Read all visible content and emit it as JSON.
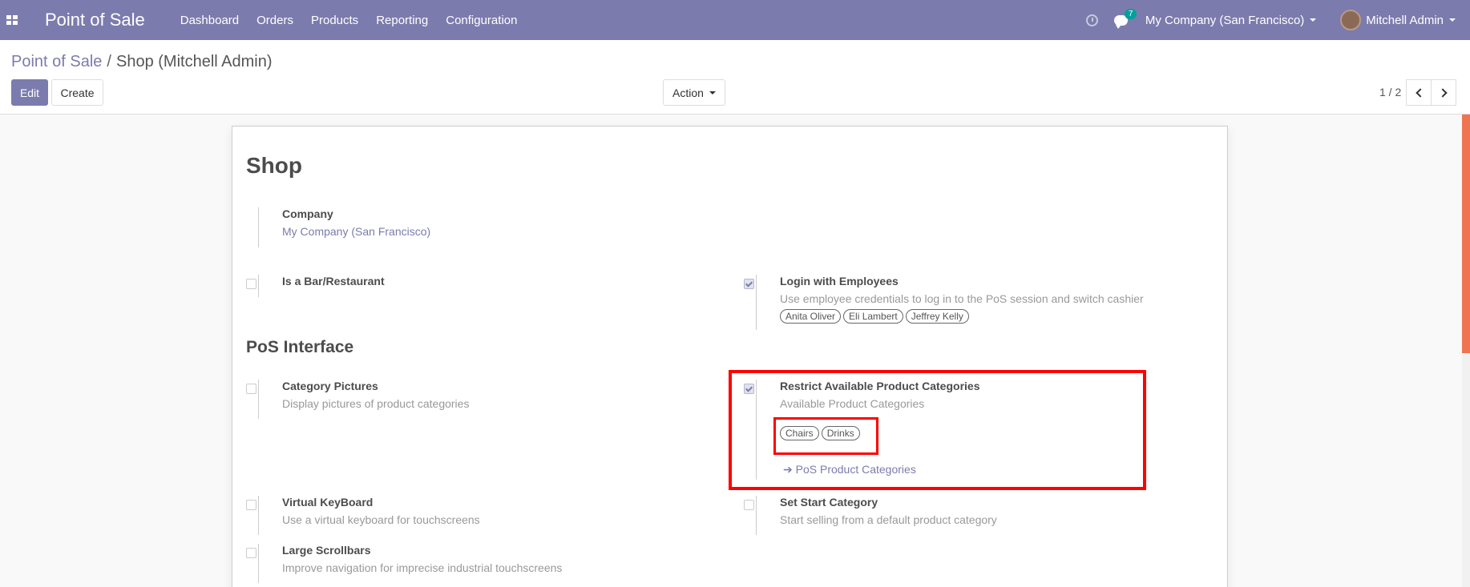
{
  "navbar": {
    "app_name": "Point of Sale",
    "menu": [
      "Dashboard",
      "Orders",
      "Products",
      "Reporting",
      "Configuration"
    ],
    "chat_count": "7",
    "company": "My Company (San Francisco)",
    "user": "Mitchell Admin",
    "color": "#7c7bad"
  },
  "breadcrumb": {
    "parent": "Point of Sale",
    "separator": "/",
    "current": "Shop (Mitchell Admin)"
  },
  "buttons": {
    "edit": "Edit",
    "create": "Create",
    "action": "Action"
  },
  "pager": {
    "value": "1 / 2"
  },
  "form": {
    "title": "Shop",
    "company_label": "Company",
    "company_value": "My Company (San Francisco)",
    "bar_restaurant": {
      "label": "Is a Bar/Restaurant",
      "checked": false
    },
    "login_employees": {
      "label": "Login with Employees",
      "desc": "Use employee credentials to log in to the PoS session and switch cashier",
      "checked": true,
      "employees": [
        "Anita Oliver",
        "Eli Lambert",
        "Jeffrey Kelly"
      ]
    },
    "pos_interface_title": "PoS Interface",
    "category_pictures": {
      "label": "Category Pictures",
      "desc": "Display pictures of product categories",
      "checked": false
    },
    "restrict_categories": {
      "label": "Restrict Available Product Categories",
      "desc": "Available Product Categories",
      "checked": true,
      "categories": [
        "Chairs",
        "Drinks"
      ],
      "link": "PoS Product Categories"
    },
    "virtual_keyboard": {
      "label": "Virtual KeyBoard",
      "desc": "Use a virtual keyboard for touchscreens",
      "checked": false
    },
    "start_category": {
      "label": "Set Start Category",
      "desc": "Start selling from a default product category",
      "checked": false
    },
    "large_scrollbars": {
      "label": "Large Scrollbars",
      "desc": "Improve navigation for imprecise industrial touchscreens",
      "checked": false
    }
  },
  "highlight_color": "#ff0000"
}
